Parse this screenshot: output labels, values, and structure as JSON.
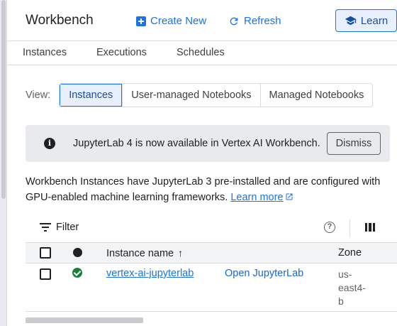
{
  "header": {
    "title": "Workbench",
    "create_label": "Create New",
    "refresh_label": "Refresh",
    "learn_label": "Learn"
  },
  "tabs": [
    {
      "label": "Instances"
    },
    {
      "label": "Executions"
    },
    {
      "label": "Schedules"
    }
  ],
  "view": {
    "label": "View:",
    "options": [
      {
        "label": "Instances",
        "selected": true
      },
      {
        "label": "User-managed Notebooks",
        "selected": false
      },
      {
        "label": "Managed Notebooks",
        "selected": false
      }
    ]
  },
  "banner": {
    "message": "JupyterLab 4 is now available in Vertex AI Workbench.",
    "dismiss_label": "Dismiss"
  },
  "description": {
    "text": "Workbench Instances have JupyterLab 3 pre-installed and are configured with GPU-enabled machine learning frameworks.",
    "link": "Learn more"
  },
  "toolbar": {
    "filter_label": "Filter"
  },
  "table": {
    "columns": {
      "name": "Instance name",
      "zone": "Zone"
    },
    "rows": [
      {
        "name": "vertex-ai-jupyterlab",
        "action": "Open JupyterLab",
        "zone": "us-east4-b",
        "zone_lines": [
          "us-",
          "east4-",
          "b"
        ],
        "status": "running"
      }
    ]
  },
  "colors": {
    "accent": "#1a73e8",
    "status_ok": "#188038",
    "banner_bg": "#e8eaed"
  }
}
